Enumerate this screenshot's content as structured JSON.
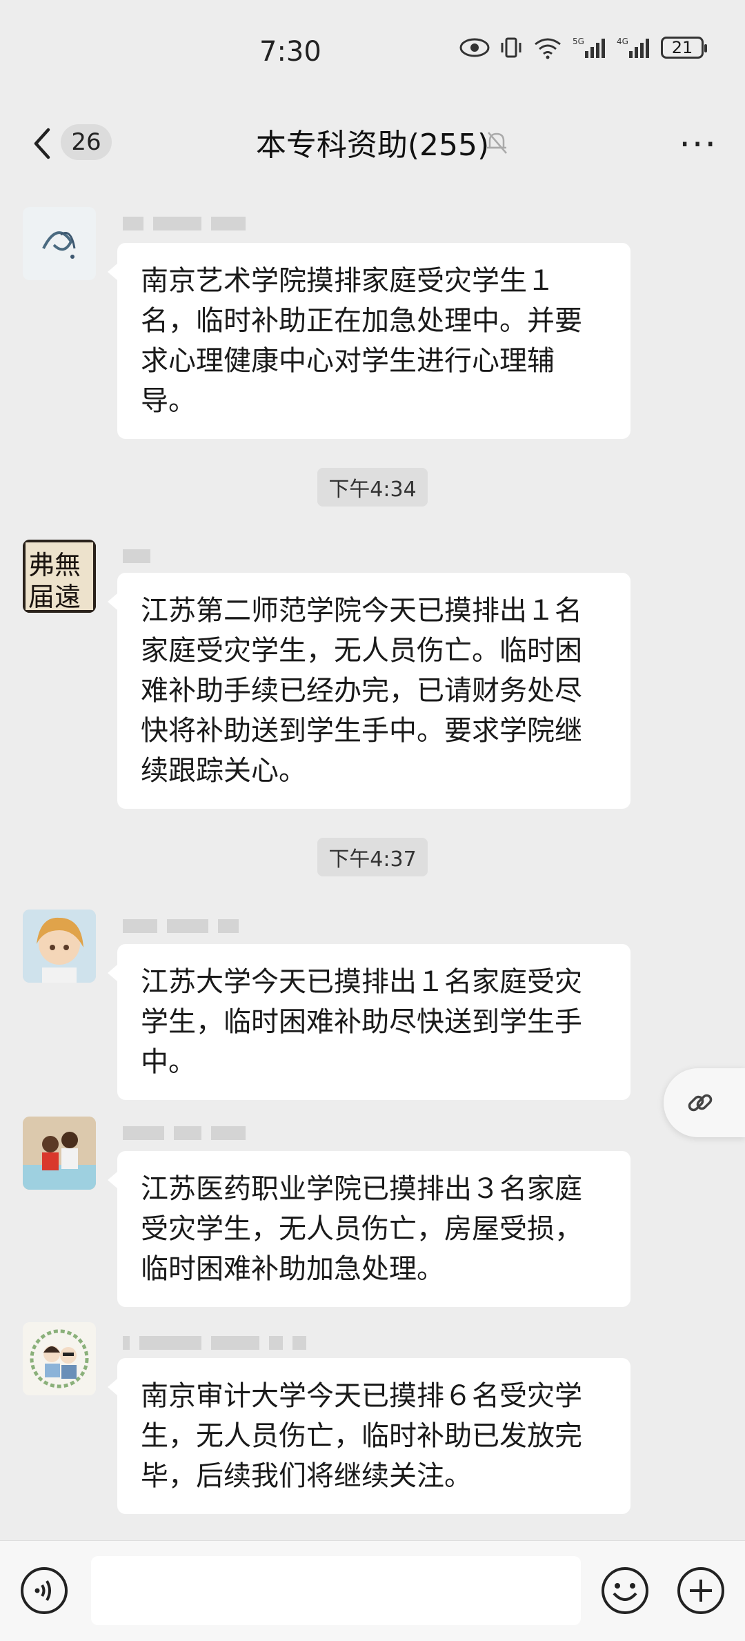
{
  "status_bar": {
    "time": "7:30",
    "battery": "21"
  },
  "header": {
    "back_badge": "26",
    "title": "本专科资助(255)"
  },
  "messages": [
    {
      "text": "南京艺术学院摸排家庭受灾学生１名，临时补助正在加急处理中。并要求心理健康中心对学生进行心理辅导。"
    },
    {
      "text": "江苏第二师范学院今天已摸排出１名家庭受灾学生，无人员伤亡。临时困难补助手续已经办完，已请财务处尽快将补助送到学生手中。要求学院继续跟踪关心。"
    },
    {
      "text": "江苏大学今天已摸排出１名家庭受灾学生，临时困难补助尽快送到学生手中。"
    },
    {
      "text": "江苏医药职业学院已摸排出３名家庭受灾学生，无人员伤亡，房屋受损，临时困难补助加急处理。"
    },
    {
      "text": "南京审计大学今天已摸排６名受灾学生，无人员伤亡，临时补助已发放完毕，后续我们将继续关注。"
    }
  ],
  "timestamps": [
    "下午4:34",
    "下午4:37"
  ],
  "avatar2_text": "弗無\n届遠"
}
